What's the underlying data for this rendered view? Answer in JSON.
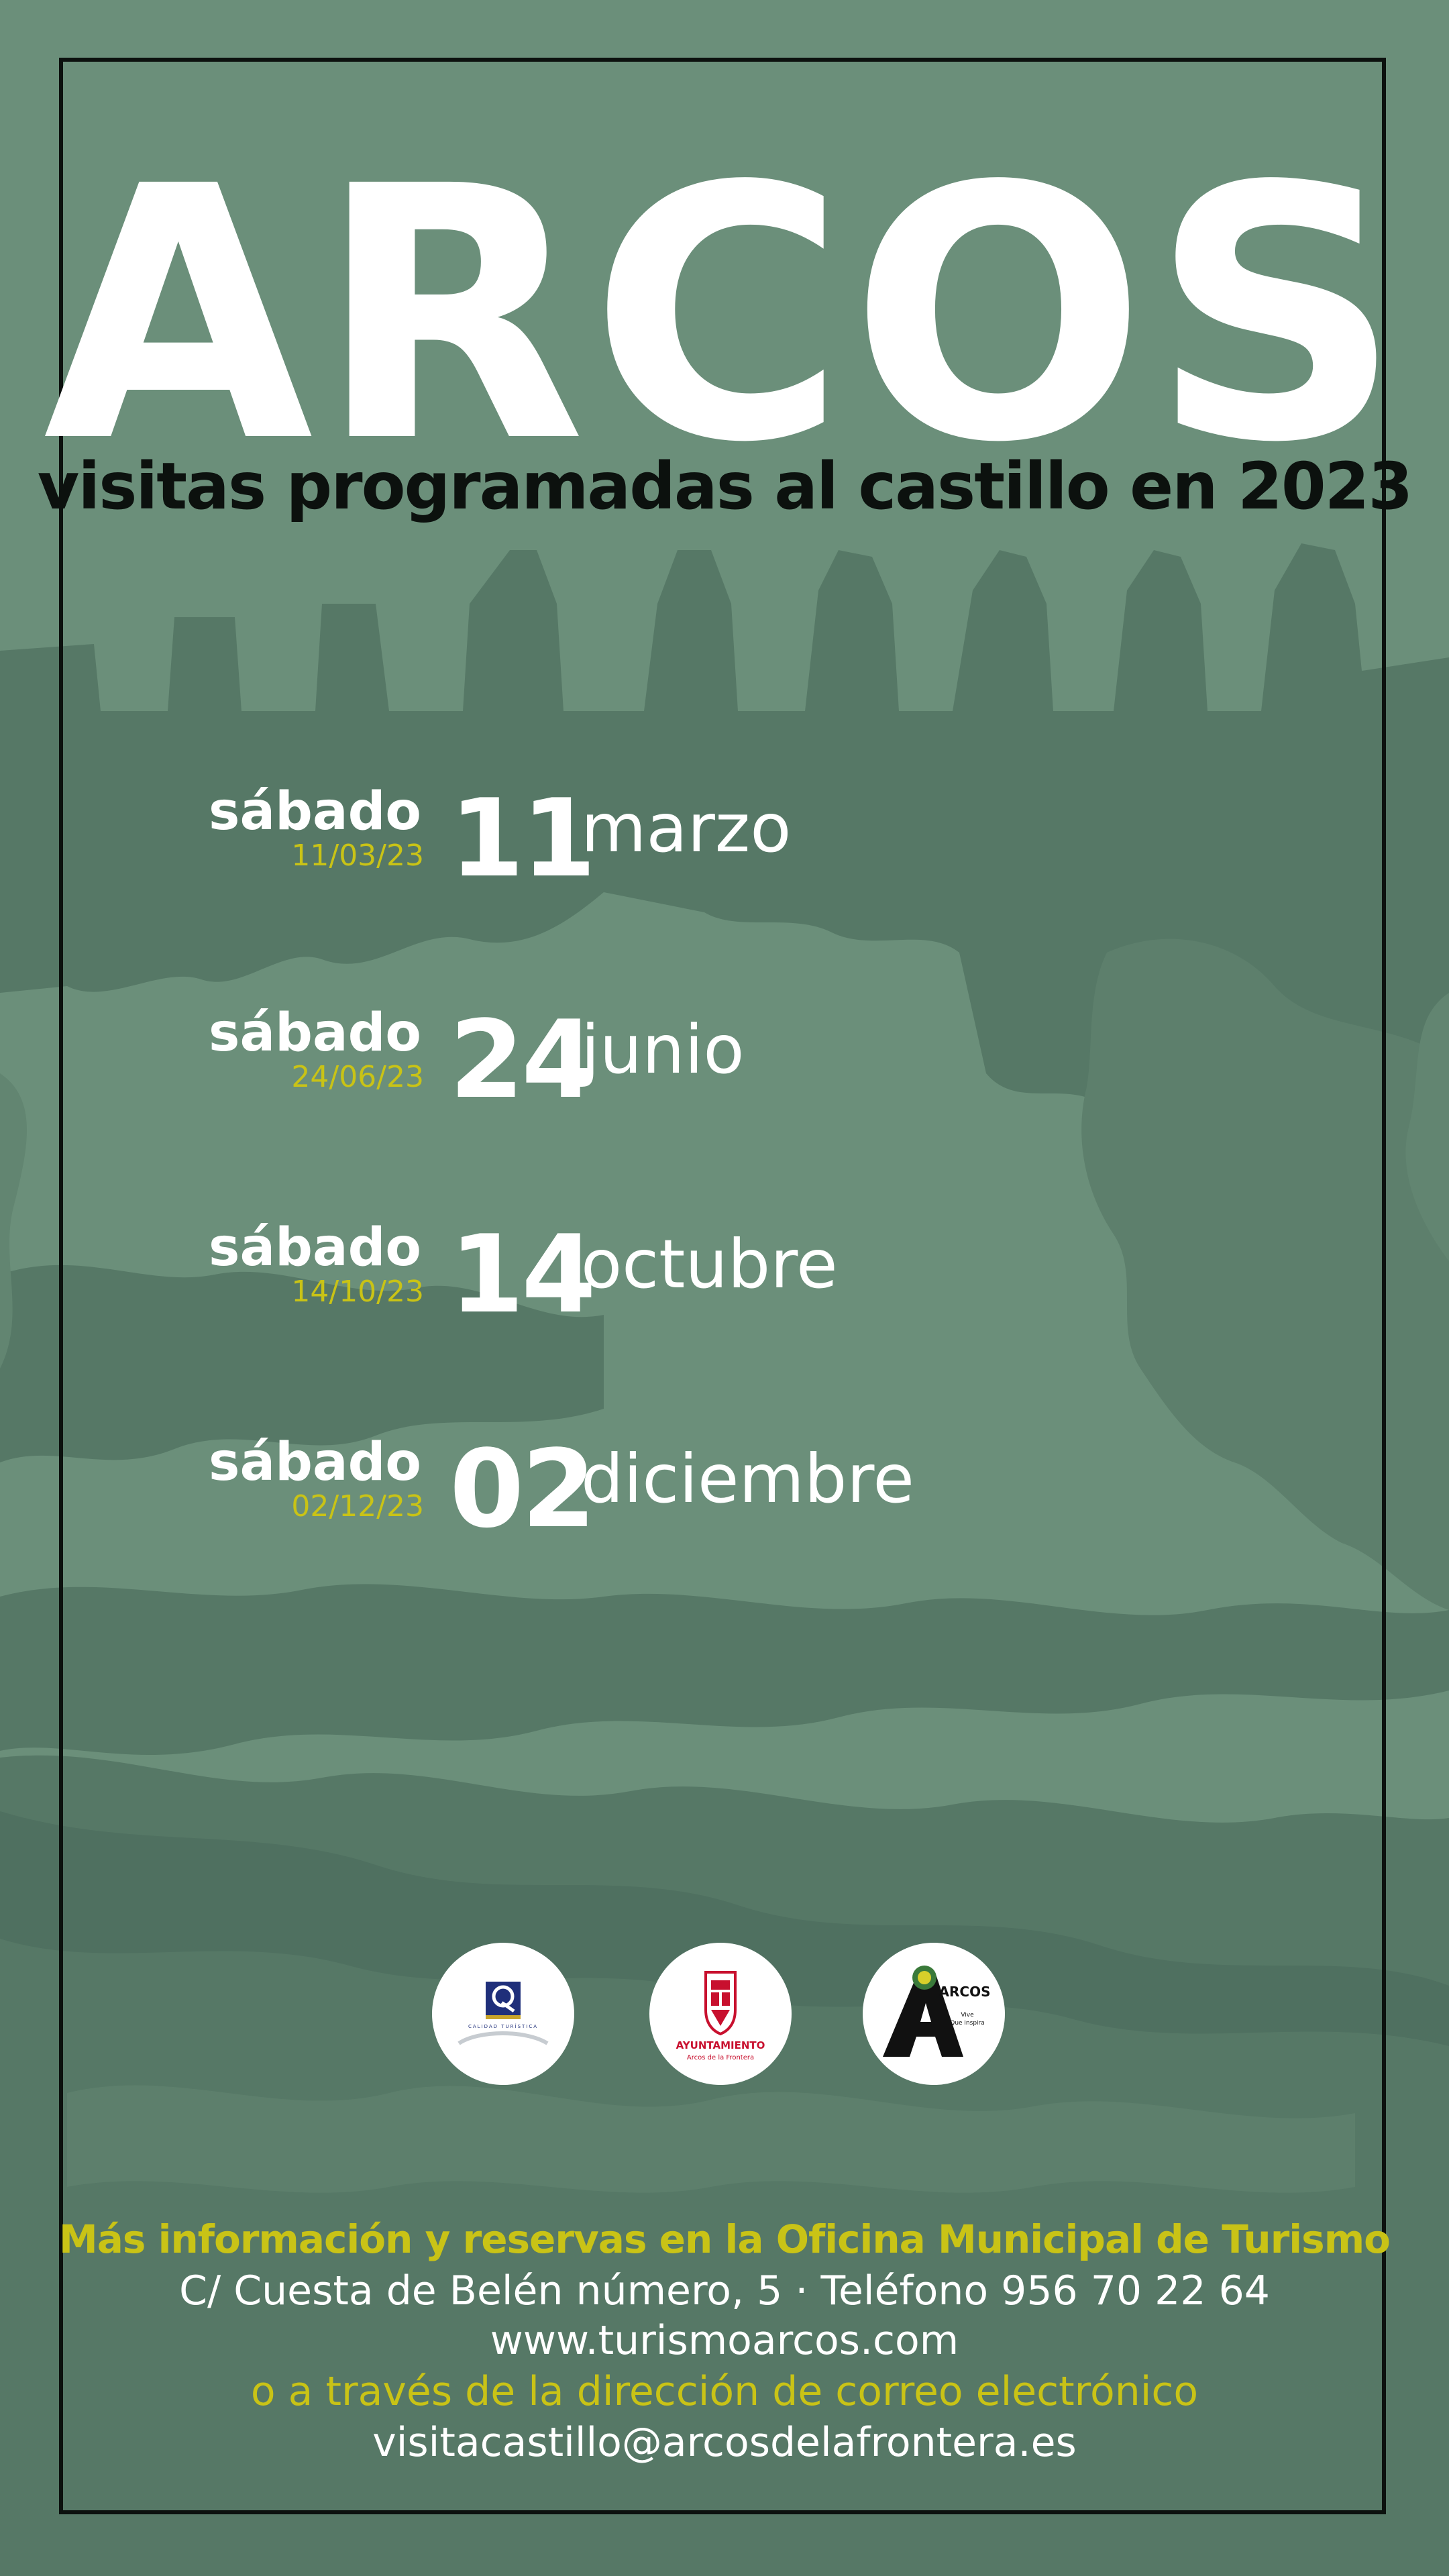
{
  "poster": {
    "title": "ARCOS",
    "subtitle": "visitas programadas al castillo en 2023"
  },
  "dates": [
    {
      "weekday": "sábado",
      "short": "11/03/23",
      "day": "11",
      "month": "marzo"
    },
    {
      "weekday": "sábado",
      "short": "24/06/23",
      "day": "24",
      "month": "junio"
    },
    {
      "weekday": "sábado",
      "short": "14/10/23",
      "day": "14",
      "month": "octubre"
    },
    {
      "weekday": "sábado",
      "short": "02/12/23",
      "day": "02",
      "month": "diciembre"
    }
  ],
  "logos": {
    "calidad_text": "CALIDAD TURÍSTICA",
    "ayuntamiento_name": "AYUNTAMIENTO",
    "ayuntamiento_town": "Arcos de la Frontera",
    "arcos_wordmark": "ARCOS",
    "arcos_tagline_1": "Vive",
    "arcos_tagline_2": "Que inspira"
  },
  "info": {
    "headline": "Más información y reservas en la Oficina Municipal de Turismo",
    "address": "C/ Cuesta de Belén número, 5 · Teléfono 956 70 22 64",
    "website": "www.turismoarcos.com",
    "email_intro": "o a través de la dirección de correo electrónico",
    "email": "visitacastillo@arcosdelafrontera.es"
  },
  "colors": {
    "background": "#6b8f7a",
    "silhouette": "#567866",
    "frame": "#0c110e",
    "accent_yellow": "#c9c316",
    "text_white": "#ffffff",
    "ayuntamiento_red": "#c8102e",
    "calidad_blue": "#1f2f7a"
  }
}
